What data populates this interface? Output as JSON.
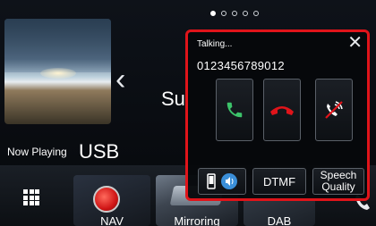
{
  "pager": {
    "pages": 5,
    "active_index": 0
  },
  "media": {
    "song_partial": "Su",
    "now_playing_label": "Now Playing",
    "source": "USB"
  },
  "bottom_bar": {
    "tiles": [
      {
        "label": "NAV"
      },
      {
        "label": "Mirroring"
      },
      {
        "label": "DAB"
      }
    ]
  },
  "call_popup": {
    "status": "Talking...",
    "phone_number": "0123456789012",
    "close_icon": "close-icon",
    "buttons": {
      "accept_icon": "phone-accept-icon",
      "reject_icon": "phone-hangup-icon",
      "mute_icon": "mic-mute-icon",
      "audio_icons": [
        "handset-icon",
        "speaker-icon"
      ],
      "dtmf_label": "DTMF",
      "speech_quality_line1": "Speech",
      "speech_quality_line2": "Quality"
    },
    "colors": {
      "border": "#e0141a",
      "accept": "#3cc36a",
      "reject": "#e0141a"
    }
  }
}
